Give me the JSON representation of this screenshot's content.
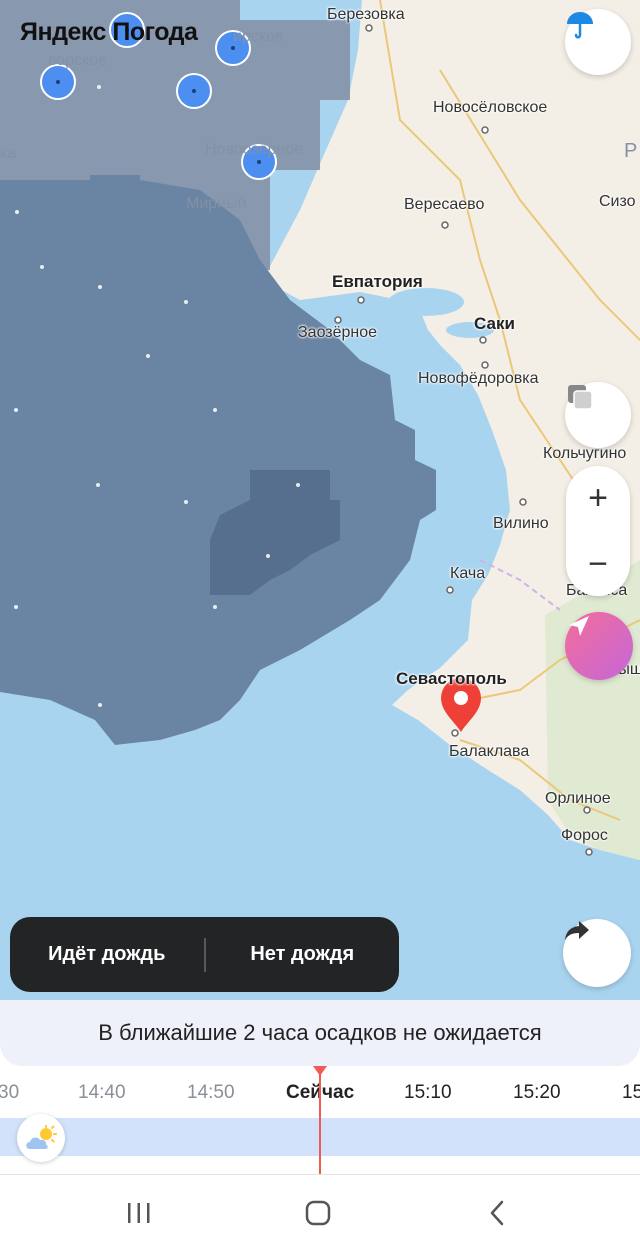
{
  "app": {
    "brand": "Яндекс Погода"
  },
  "map": {
    "cities": [
      {
        "name": "Березовка",
        "style": "normal",
        "pos": "a"
      },
      {
        "name": "Новосёловское",
        "style": "normal",
        "pos": "b"
      },
      {
        "name": "Вересаево",
        "style": "normal",
        "pos": "c"
      },
      {
        "name": "Евпатория",
        "style": "big",
        "pos": "d"
      },
      {
        "name": "Саки",
        "style": "big",
        "pos": "e"
      },
      {
        "name": "Заозёрное",
        "style": "normal",
        "pos": "f"
      },
      {
        "name": "Новофёдоровка",
        "style": "normal",
        "pos": "g"
      },
      {
        "name": "Кольчугино",
        "style": "normal",
        "pos": "h"
      },
      {
        "name": "Вилино",
        "style": "normal",
        "pos": "i"
      },
      {
        "name": "Кача",
        "style": "normal",
        "pos": "j"
      },
      {
        "name": "Севастополь",
        "style": "big",
        "pos": "k"
      },
      {
        "name": "Балаклава",
        "style": "normal",
        "pos": "l"
      },
      {
        "name": "Орлиное",
        "style": "normal",
        "pos": "m"
      },
      {
        "name": "Форос",
        "style": "normal",
        "pos": "n"
      },
      {
        "name": "Новоозёрное",
        "style": "faded",
        "pos": "o"
      },
      {
        "name": "Мирный",
        "style": "faded",
        "pos": "p"
      },
      {
        "name": "ирское",
        "style": "faded",
        "pos": "q"
      },
      {
        "name": "ворское",
        "style": "faded",
        "pos": "r"
      },
      {
        "name": "ка",
        "style": "faded",
        "pos": "s"
      },
      {
        "name": "Сизо",
        "style": "normal",
        "pos": "t"
      },
      {
        "name": "Бахчиса",
        "style": "normal",
        "pos": "u"
      },
      {
        "name": "Куйбыш",
        "style": "normal",
        "pos": "v"
      },
      {
        "name": "Р",
        "style": "faded",
        "pos": "w"
      }
    ],
    "colors": {
      "sea": "#a9d4f0",
      "land": "#f4efe6",
      "rain_light": "#6a84a4",
      "rain_heavy": "#566f8e",
      "rain_far": "#8594a9"
    }
  },
  "controls": {
    "precip_icon": "umbrella-icon",
    "layers_icon": "layers-icon",
    "zoom_in": "+",
    "zoom_out": "−",
    "locate_icon": "navigation-arrow-icon",
    "share_icon": "share-arrow-icon"
  },
  "rain_toggle": {
    "raining": "Идёт дождь",
    "no_rain": "Нет дождя"
  },
  "forecast": {
    "text": "В ближайшие 2 часа осадков не ожидается"
  },
  "timeline": {
    "ticks": [
      "30",
      "14:40",
      "14:50",
      "Сейчас",
      "15:10",
      "15:20",
      "15"
    ],
    "weather_icon": "partly-cloudy-icon"
  },
  "navbar": {
    "recents_icon": "recents-icon",
    "home_icon": "home-icon",
    "back_icon": "back-icon"
  }
}
